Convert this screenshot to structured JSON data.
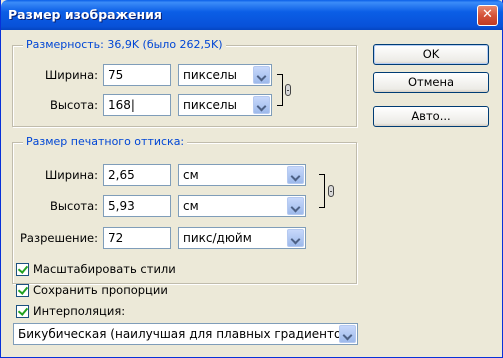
{
  "window": {
    "title": "Размер изображения",
    "close_icon": "close-icon"
  },
  "pixel_group": {
    "label": "Размерность:  36,9K (было 262,5K)",
    "width_label": "Ширина:",
    "width_value": "75",
    "width_unit": "пикселы",
    "height_label": "Высота:",
    "height_value": "168",
    "height_unit": "пикселы"
  },
  "print_group": {
    "label": "Размер печатного оттиска:",
    "width_label": "Ширина:",
    "width_value": "2,65",
    "width_unit": "см",
    "height_label": "Высота:",
    "height_value": "5,93",
    "height_unit": "см",
    "resolution_label": "Разрешение:",
    "resolution_value": "72",
    "resolution_unit": "пикс/дюйм"
  },
  "buttons": {
    "ok": "OK",
    "cancel": "Отмена",
    "auto": "Авто..."
  },
  "options": {
    "scale_styles": {
      "label": "Масштабировать стили",
      "checked": true
    },
    "constrain": {
      "label": "Сохранить пропорции",
      "checked": true
    },
    "resample": {
      "label": "Интерполяция:",
      "checked": true
    }
  },
  "resample_method": "Бикубическая (наилучшая для плавных градиентов)"
}
